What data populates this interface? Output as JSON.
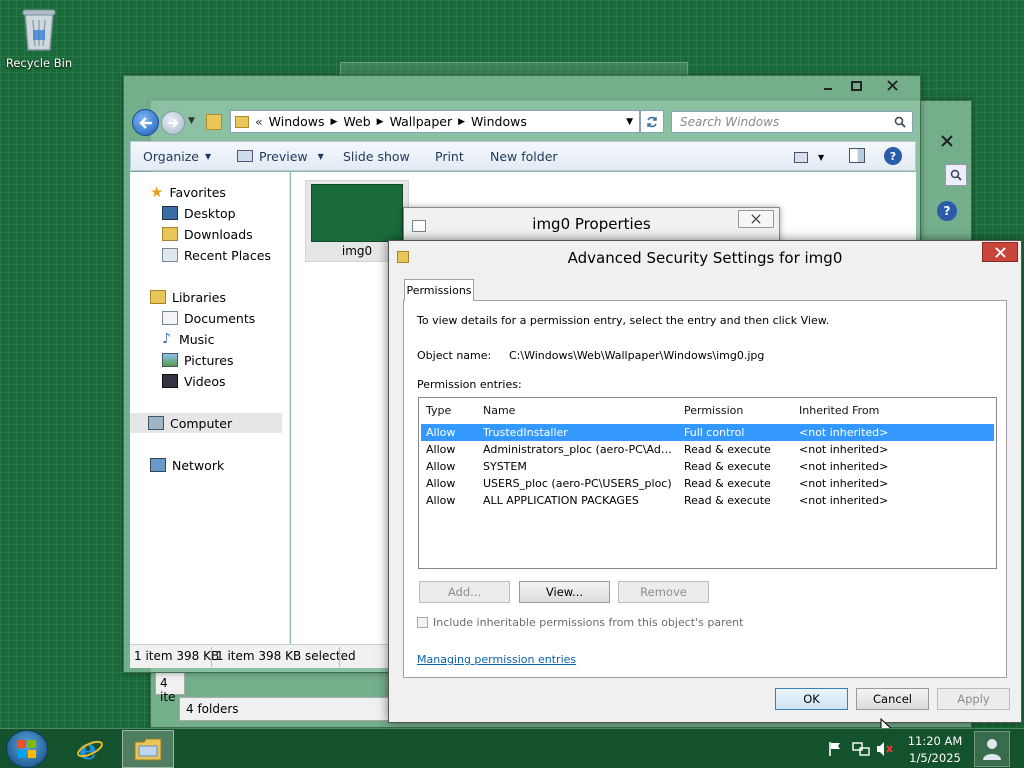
{
  "desktop": {
    "recycle_bin_label": "Recycle Bin"
  },
  "explorer": {
    "address": {
      "overflow": "«",
      "crumbs": [
        "Windows",
        "Web",
        "Wallpaper",
        "Windows"
      ]
    },
    "search_placeholder": "Search Windows",
    "toolbar": {
      "organize": "Organize",
      "preview": "Preview",
      "slideshow": "Slide show",
      "print": "Print",
      "new_folder": "New folder"
    },
    "nav": {
      "favorites": "Favorites",
      "desktop": "Desktop",
      "downloads": "Downloads",
      "recent": "Recent Places",
      "libraries": "Libraries",
      "documents": "Documents",
      "music": "Music",
      "pictures": "Pictures",
      "videos": "Videos",
      "computer": "Computer",
      "network": "Network"
    },
    "file_label": "img0",
    "status_items": "1 item 398 KB",
    "status_selected": "1 item 398 KB selected"
  },
  "back_explorer": {
    "status_text": "4 ite",
    "folders_text": "4 folders"
  },
  "properties": {
    "title": "img0 Properties"
  },
  "advanced": {
    "title": "Advanced Security Settings for img0",
    "tab": "Permissions",
    "instructions": "To view details for a permission entry, select the entry and then click View.",
    "object_label": "Object name:",
    "object_value": "C:\\Windows\\Web\\Wallpaper\\Windows\\img0.jpg",
    "entries_label": "Permission entries:",
    "columns": [
      "Type",
      "Name",
      "Permission",
      "Inherited From"
    ],
    "rows": [
      {
        "type": "Allow",
        "name": "TrustedInstaller",
        "permission": "Full control",
        "inherited": "<not inherited>"
      },
      {
        "type": "Allow",
        "name": "Administrators_ploc (aero-PC\\Admini...",
        "permission": "Read & execute",
        "inherited": "<not inherited>"
      },
      {
        "type": "Allow",
        "name": "SYSTEM",
        "permission": "Read & execute",
        "inherited": "<not inherited>"
      },
      {
        "type": "Allow",
        "name": "USERS_ploc (aero-PC\\USERS_ploc)",
        "permission": "Read & execute",
        "inherited": "<not inherited>"
      },
      {
        "type": "Allow",
        "name": "ALL APPLICATION PACKAGES",
        "permission": "Read & execute",
        "inherited": "<not inherited>"
      }
    ],
    "add": "Add...",
    "view": "View...",
    "remove": "Remove",
    "inherit_checkbox": "Include inheritable permissions from this object's parent",
    "link": "Managing permission entries",
    "ok": "OK",
    "cancel": "Cancel",
    "apply": "Apply"
  },
  "taskbar": {
    "time": "11:20 AM",
    "date": "1/5/2025"
  },
  "colors": {
    "desktop": "#1a6b3a",
    "glass": "#96c8aa",
    "selection": "#3399ff",
    "close_red": "#c7453a",
    "link_blue": "#0a62b0"
  }
}
